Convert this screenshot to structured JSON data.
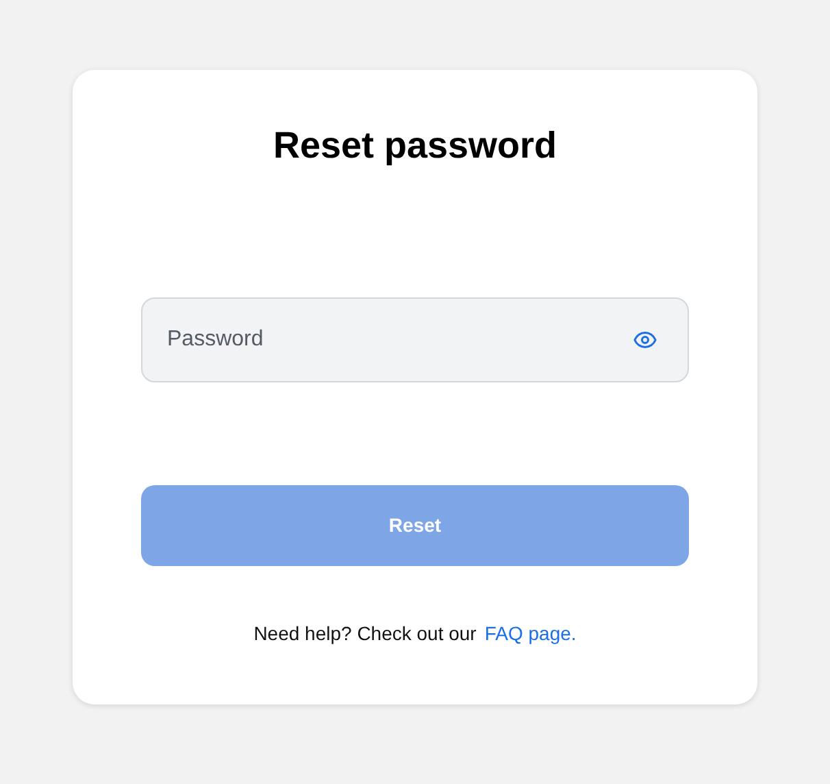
{
  "title": "Reset password",
  "password_field": {
    "placeholder": "Password"
  },
  "reset_button": {
    "label": "Reset",
    "disabled": true
  },
  "help": {
    "text": "Need help? Check out our",
    "link": "FAQ page."
  }
}
